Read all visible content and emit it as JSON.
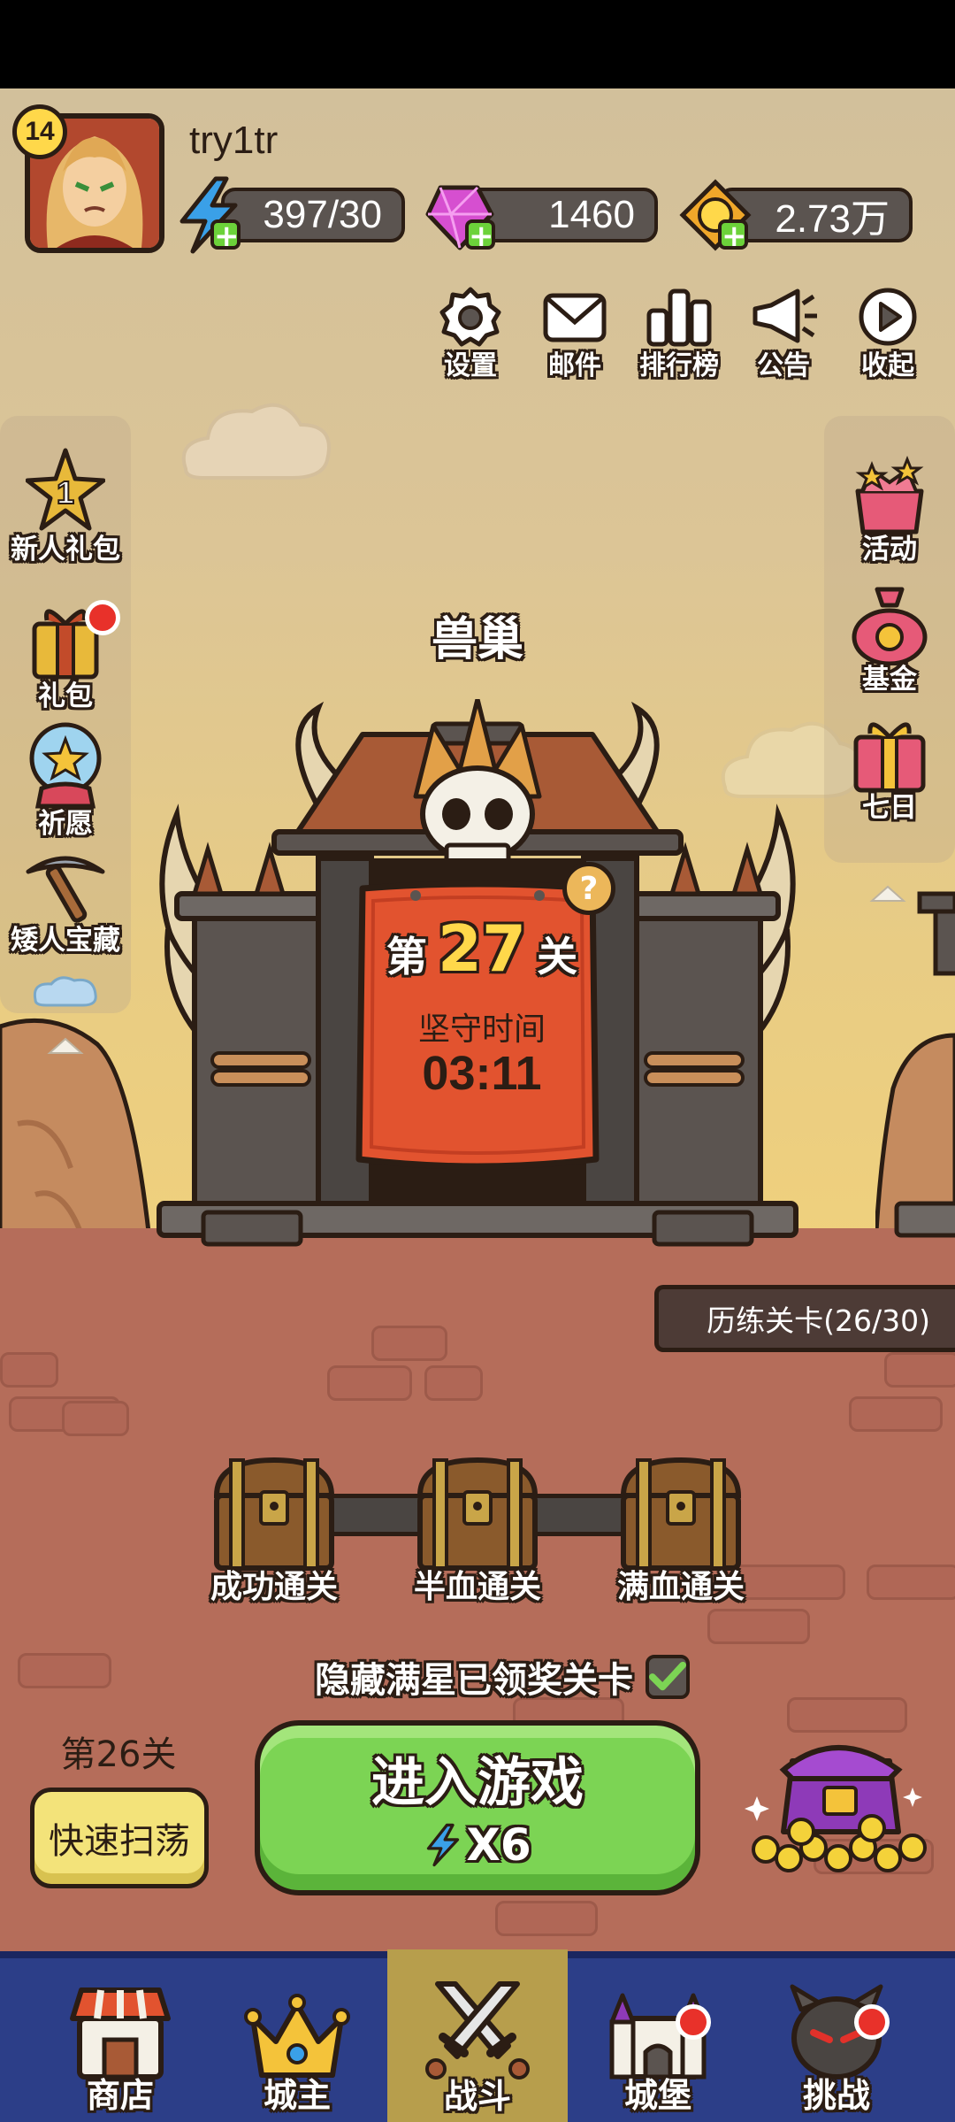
{
  "player": {
    "level": "14",
    "name": "try1tr",
    "energy": "397/30",
    "gems": "1460",
    "gold": "2.73万"
  },
  "top_menu": [
    {
      "label": "设置",
      "icon": "gear-icon"
    },
    {
      "label": "邮件",
      "icon": "mail-icon"
    },
    {
      "label": "排行榜",
      "icon": "leaderboard-icon"
    },
    {
      "label": "公告",
      "icon": "megaphone-icon"
    },
    {
      "label": "收起",
      "icon": "collapse-play-icon"
    }
  ],
  "left_menu": [
    {
      "label": "新人礼包",
      "icon": "star-one-icon",
      "badge_text": "1"
    },
    {
      "label": "礼包",
      "icon": "gift-box-icon"
    },
    {
      "label": "祈愿",
      "icon": "wish-orb-icon"
    },
    {
      "label": "矮人宝藏",
      "icon": "pickaxe-icon"
    }
  ],
  "right_menu": [
    {
      "label": "活动",
      "icon": "event-box-icon"
    },
    {
      "label": "基金",
      "icon": "money-bag-icon"
    },
    {
      "label": "七日",
      "icon": "seven-day-gift-icon"
    }
  ],
  "stage": {
    "name": "兽巢",
    "prefix": "第",
    "number": "27",
    "suffix": "关",
    "hold_label": "坚守时间",
    "hold_time": "03:11",
    "help": "?"
  },
  "trial_levels": "历练关卡(26/30)",
  "chests": [
    {
      "label": "成功通关"
    },
    {
      "label": "半血通关"
    },
    {
      "label": "满血通关"
    }
  ],
  "hide_option": {
    "label": "隐藏满星已领奖关卡",
    "checked": true
  },
  "sweep": {
    "level": "第26关",
    "button": "快速扫荡"
  },
  "enter_game": {
    "label": "进入游戏",
    "cost": "X6"
  },
  "bottom_nav": [
    {
      "label": "商店",
      "icon": "shop-icon"
    },
    {
      "label": "城主",
      "icon": "crown-icon"
    },
    {
      "label": "战斗",
      "icon": "crossed-swords-icon",
      "active": true
    },
    {
      "label": "城堡",
      "icon": "castle-icon"
    },
    {
      "label": "挑战",
      "icon": "demon-icon"
    }
  ],
  "colors": {
    "enter_button": "#7cd454",
    "sweep_button": "#f3e37a",
    "nav_bg": "#2c3e88",
    "nav_active": "#b79e4c",
    "door_red": "#e2532f",
    "ground": "#b56d5a"
  }
}
